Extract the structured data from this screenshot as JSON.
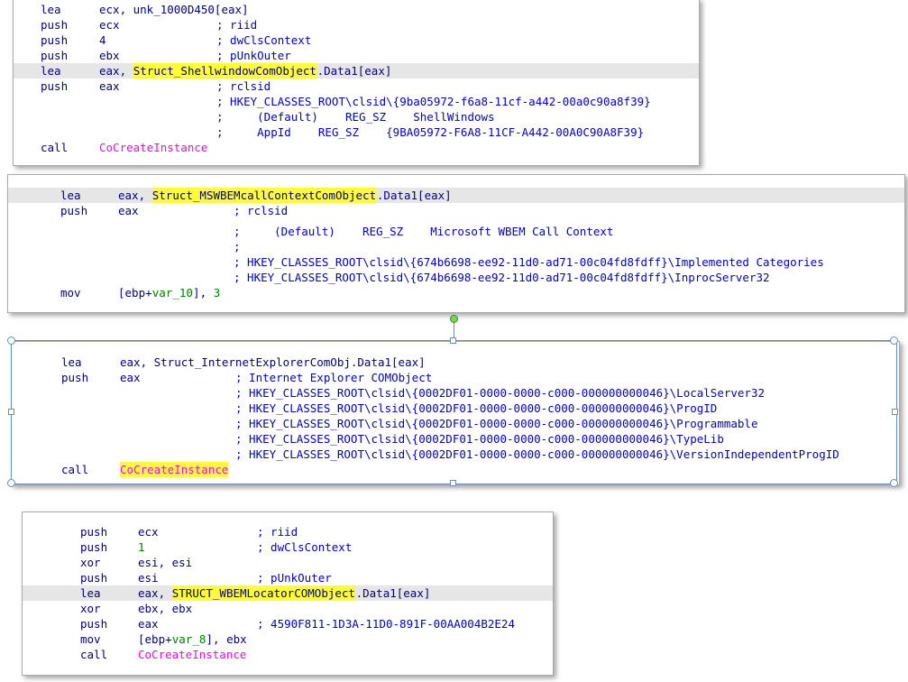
{
  "panel1": {
    "lines": [
      {
        "m": "lea",
        "a": "ecx, unk_1000D450[eax]"
      },
      {
        "m": "push",
        "a": "ecx",
        "c": "; riid"
      },
      {
        "m": "push",
        "a": "4",
        "c": "; dwClsContext"
      },
      {
        "m": "push",
        "a": "ebx",
        "c": "; pUnkOuter"
      },
      {
        "m": "lea",
        "a_pre": "eax, ",
        "sym": "Struct_ShellwindowComObject",
        "a_post": ".Data1[eax]"
      },
      {
        "m": "push",
        "a": "eax",
        "c": "; rclsid"
      },
      {
        "c": "; HKEY_CLASSES_ROOT\\clsid\\{9ba05972-f6a8-11cf-a442-00a0c90a8f39}"
      },
      {
        "c": ";     (Default)    REG_SZ    ShellWindows"
      },
      {
        "c": ";     AppId    REG_SZ    {9BA05972-F6A8-11CF-A442-00A0C90A8F39}"
      },
      {
        "m": "call",
        "fn": "CoCreateInstance"
      }
    ]
  },
  "panel2": {
    "lines": [
      {
        "m": "lea",
        "a_pre": "eax, ",
        "sym": "Struct_MSWBEMcallContextComObject",
        "a_post": ".Data1[eax]"
      },
      {
        "m": "push",
        "a": "eax",
        "c": "; rclsid"
      },
      {
        "c": ";     (Default)    REG_SZ    Microsoft WBEM Call Context"
      },
      {
        "c": ";"
      },
      {
        "c": "; HKEY_CLASSES_ROOT\\clsid\\{674b6698-ee92-11d0-ad71-00c04fd8fdff}\\Implemented Categories"
      },
      {
        "c": "; HKEY_CLASSES_ROOT\\clsid\\{674b6698-ee92-11d0-ad71-00c04fd8fdff}\\InprocServer32"
      },
      {
        "m": "mov",
        "a_pre": "[ebp+",
        "var": "var_10",
        "a_post": "], ",
        "num": "3"
      }
    ]
  },
  "panel3": {
    "lines": [
      {
        "m": "lea",
        "a": "eax, Struct_InternetExplorerComObj.Data1[eax]"
      },
      {
        "m": "push",
        "a": "eax",
        "c": "; Internet Explorer COMObject"
      },
      {
        "c": "; HKEY_CLASSES_ROOT\\clsid\\{0002DF01-0000-0000-c000-000000000046}\\LocalServer32"
      },
      {
        "c": "; HKEY_CLASSES_ROOT\\clsid\\{0002DF01-0000-0000-c000-000000000046}\\ProgID"
      },
      {
        "c": "; HKEY_CLASSES_ROOT\\clsid\\{0002DF01-0000-0000-c000-000000000046}\\Programmable"
      },
      {
        "c": "; HKEY_CLASSES_ROOT\\clsid\\{0002DF01-0000-0000-c000-000000000046}\\TypeLib"
      },
      {
        "c": "; HKEY_CLASSES_ROOT\\clsid\\{0002DF01-0000-0000-c000-000000000046}\\VersionIndependentProgID"
      },
      {
        "m": "call",
        "fn_hl": "CoCreateInstance"
      }
    ]
  },
  "panel4": {
    "lines": [
      {
        "m": "push",
        "a": "ecx",
        "c": "; riid"
      },
      {
        "m": "push",
        "num": "1",
        "c": "; dwClsContext"
      },
      {
        "m": "xor",
        "a": "esi, esi"
      },
      {
        "m": "push",
        "a": "esi",
        "c": "; pUnkOuter"
      },
      {
        "m": "lea",
        "a_pre": "eax, ",
        "sym": "STRUCT_WBEMLocatorCOMObject",
        "a_post": ".Data1[eax]"
      },
      {
        "m": "xor",
        "a": "ebx, ebx"
      },
      {
        "m": "push",
        "a": "eax",
        "c": "; 4590F811-1D3A-11D0-891F-00AA004B2E24"
      },
      {
        "m": "mov",
        "a_pre": "[ebp+",
        "var": "var_8",
        "a_post": "], ebx"
      },
      {
        "m": "call",
        "fn": "CoCreateInstance"
      }
    ]
  },
  "colors": {
    "mnemonic": "#000080",
    "comment": "#0000c8",
    "number": "#008000",
    "function": "#ff00ff",
    "highlight": "#ffff33",
    "row_highlight": "#e6e6e6"
  }
}
